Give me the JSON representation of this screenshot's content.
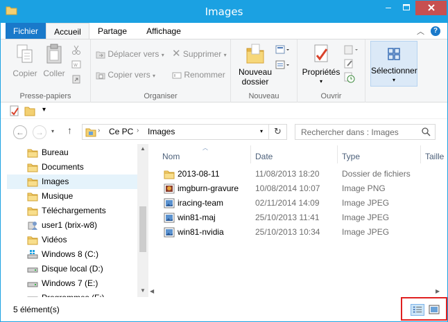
{
  "window": {
    "title": "Images"
  },
  "tabs": [
    "Fichier",
    "Accueil",
    "Partage",
    "Affichage"
  ],
  "ribbon": {
    "presse_papiers": {
      "label": "Presse-papiers",
      "copier": "Copier",
      "coller": "Coller"
    },
    "organiser": {
      "label": "Organiser",
      "deplacer": "Déplacer vers",
      "copier_vers": "Copier vers",
      "supprimer": "Supprimer",
      "renommer": "Renommer"
    },
    "nouveau": {
      "label": "Nouveau",
      "nouveau_dossier_l1": "Nouveau",
      "nouveau_dossier_l2": "dossier"
    },
    "ouvrir": {
      "label": "Ouvrir",
      "proprietes": "Propriétés"
    },
    "selectionner": {
      "label": "Sélectionner"
    }
  },
  "address": {
    "root": "Ce PC",
    "sep": "›",
    "current": "Images"
  },
  "search": {
    "placeholder": "Rechercher dans : Images"
  },
  "navpane": {
    "items": [
      {
        "label": "Bureau",
        "icon": "folder-icon"
      },
      {
        "label": "Documents",
        "icon": "folder-icon"
      },
      {
        "label": "Images",
        "icon": "folder-icon",
        "selected": true
      },
      {
        "label": "Musique",
        "icon": "folder-icon"
      },
      {
        "label": "Téléchargements",
        "icon": "folder-icon"
      },
      {
        "label": "user1 (brix-w8)",
        "icon": "user-folder-icon"
      },
      {
        "label": "Vidéos",
        "icon": "folder-icon"
      },
      {
        "label": "Windows 8 (C:)",
        "icon": "windows-drive-icon"
      },
      {
        "label": "Disque local (D:)",
        "icon": "drive-icon"
      },
      {
        "label": "Windows 7 (E:)",
        "icon": "drive-icon"
      },
      {
        "label": "Programmes (F:)",
        "icon": "drive-icon"
      }
    ]
  },
  "filelist": {
    "columns": [
      "Nom",
      "Date",
      "Type",
      "Taille"
    ],
    "rows": [
      {
        "name": "2013-08-11",
        "date": "11/08/2013 18:20",
        "type": "Dossier de fichiers",
        "icon": "folder-icon"
      },
      {
        "name": "imgburn-gravure",
        "date": "10/08/2014 10:07",
        "type": "Image PNG",
        "icon": "png-image-icon"
      },
      {
        "name": "iracing-team",
        "date": "02/11/2014 14:09",
        "type": "Image JPEG",
        "icon": "jpeg-image-icon"
      },
      {
        "name": "win81-maj",
        "date": "25/10/2013 11:41",
        "type": "Image JPEG",
        "icon": "jpeg-image-icon"
      },
      {
        "name": "win81-nvidia",
        "date": "25/10/2013 10:34",
        "type": "Image JPEG",
        "icon": "jpeg-image-icon"
      }
    ]
  },
  "status": {
    "count": "5 élément(s)"
  },
  "colors": {
    "titlebar": "#1ba1e2",
    "file_tab": "#1979ca",
    "close": "#c75050",
    "selected": "#e5f3fb",
    "highlight": "#e02020"
  }
}
